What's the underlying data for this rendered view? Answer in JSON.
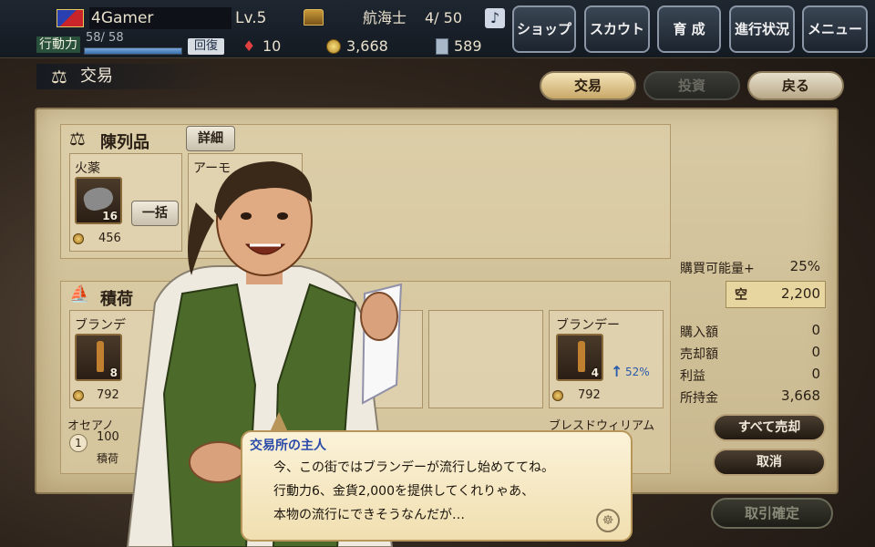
{
  "hud": {
    "player_name": "4Gamer",
    "level": "Lv.5",
    "rank": "航海士",
    "rank_count": "4/ 50",
    "music_glyph": "♪",
    "stamina_label": "行動力",
    "stamina_text": "58/ 58",
    "stamina_ratio": 1.0,
    "recover_label": "回復",
    "gems": "10",
    "gold": "3,668",
    "tickets": "589",
    "menu": [
      "ショップ",
      "スカウト",
      "育 成",
      "進行状況",
      "メニュー"
    ]
  },
  "section": {
    "title": "交易",
    "tabs": {
      "trade": "交易",
      "invest": "投資",
      "back": "戻る"
    }
  },
  "display": {
    "title": "陳列品",
    "detail_label": "詳細",
    "bulk_label": "一括",
    "items": [
      {
        "name": "火薬",
        "qty": "16",
        "price": "456"
      },
      {
        "name": "アーモ",
        "qty": "",
        "price": ""
      }
    ]
  },
  "cargo": {
    "title": "積荷",
    "left_item": {
      "name": "ブランデ",
      "qty": "8",
      "price": "792"
    },
    "right_item": {
      "name": "ブランデー",
      "qty": "4",
      "price": "792",
      "trend": "52%"
    },
    "ship_name": "オセアノ",
    "ship_sub": "積荷",
    "ship_value": "100",
    "ship_badge": "1",
    "market_name": "ブレスドウィリアム"
  },
  "stats": {
    "purchasable_label": "購買可能量+",
    "purchasable_value": "25%",
    "capacity_value": "2,200",
    "hull_glyph": "空",
    "buy_label": "購入額",
    "buy_value": "0",
    "sell_label": "売却額",
    "sell_value": "0",
    "profit_label": "利益",
    "profit_value": "0",
    "funds_label": "所持金",
    "funds_value": "3,668",
    "sell_all_label": "すべて売却",
    "cancel_label": "取消",
    "confirm_label": "取引確定"
  },
  "dialog": {
    "speaker": "交易所の主人",
    "lines": [
      "今、この街ではブランデーが流行し始めててね。",
      "行動力6、金貨2,000を提供してくれりゃあ、",
      "本物の流行にできそうなんだが…"
    ]
  }
}
